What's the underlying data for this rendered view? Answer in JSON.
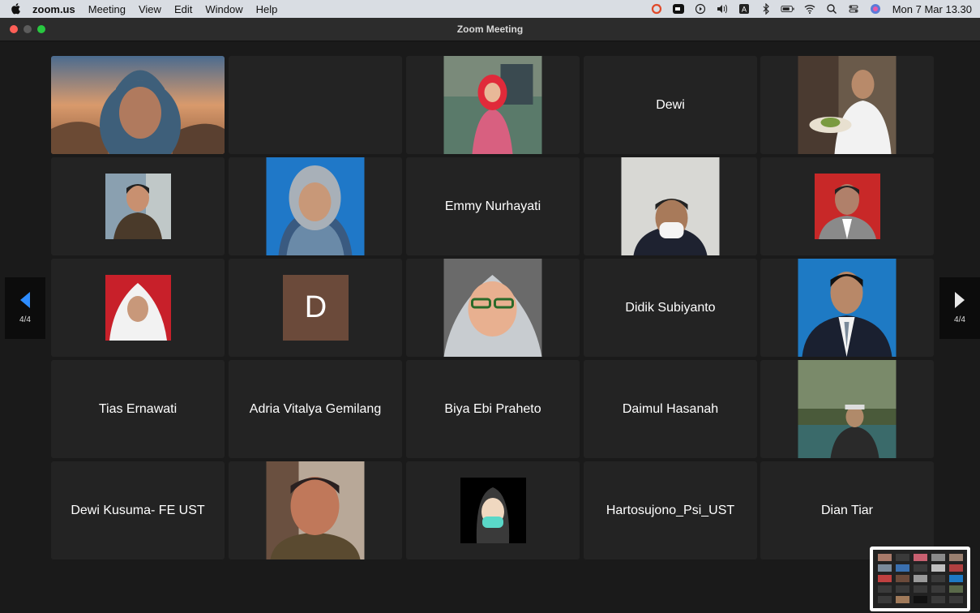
{
  "menubar": {
    "app": "zoom.us",
    "items": [
      "Meeting",
      "View",
      "Edit",
      "Window",
      "Help"
    ],
    "clock": "Mon 7 Mar  13.30",
    "icons": [
      "sync-icon",
      "zoom-app-icon",
      "play-icon",
      "volume-icon",
      "keyboard-input-icon",
      "bluetooth-icon",
      "battery-icon",
      "wifi-icon",
      "spotlight-search-icon",
      "control-center-icon",
      "siri-icon"
    ]
  },
  "window": {
    "title": "Zoom Meeting"
  },
  "pager": {
    "left_label": "4/4",
    "right_label": "4/4"
  },
  "tiles": [
    {
      "name": "",
      "kind": "video-hijab-blue"
    },
    {
      "name": "",
      "kind": "empty"
    },
    {
      "name": "",
      "kind": "photo-red-hijab"
    },
    {
      "name": "Dewi",
      "kind": "text"
    },
    {
      "name": "",
      "kind": "photo-chef"
    },
    {
      "name": "",
      "kind": "photo-small-man"
    },
    {
      "name": "",
      "kind": "photo-hijab-blue-bg"
    },
    {
      "name": "Emmy Nurhayati",
      "kind": "text"
    },
    {
      "name": "",
      "kind": "photo-mask-man"
    },
    {
      "name": "",
      "kind": "photo-man-red-bg"
    },
    {
      "name": "",
      "kind": "photo-white-hijab-red-bg"
    },
    {
      "name": "",
      "kind": "avatar",
      "initial": "D"
    },
    {
      "name": "",
      "kind": "photo-glasses-hijab"
    },
    {
      "name": "Didik Subiyanto",
      "kind": "text"
    },
    {
      "name": "",
      "kind": "photo-man-blue-bg"
    },
    {
      "name": "Tias Ernawati",
      "kind": "text"
    },
    {
      "name": "Adria Vitalya Gemilang",
      "kind": "text"
    },
    {
      "name": "Biya Ebi Praheto",
      "kind": "text"
    },
    {
      "name": "Daimul Hasanah",
      "kind": "text"
    },
    {
      "name": "",
      "kind": "photo-river"
    },
    {
      "name": "Dewi Kusuma- FE UST",
      "kind": "text"
    },
    {
      "name": "",
      "kind": "photo-older-man"
    },
    {
      "name": "",
      "kind": "photo-mask-avatar"
    },
    {
      "name": "Hartosujono_Psi_UST",
      "kind": "text"
    },
    {
      "name": "Dian Tiar",
      "kind": "text"
    }
  ],
  "colors": {
    "menubar": "#d9dde3",
    "tile": "#232323",
    "background": "#1a1a1a",
    "accent": "#2d8cff"
  }
}
